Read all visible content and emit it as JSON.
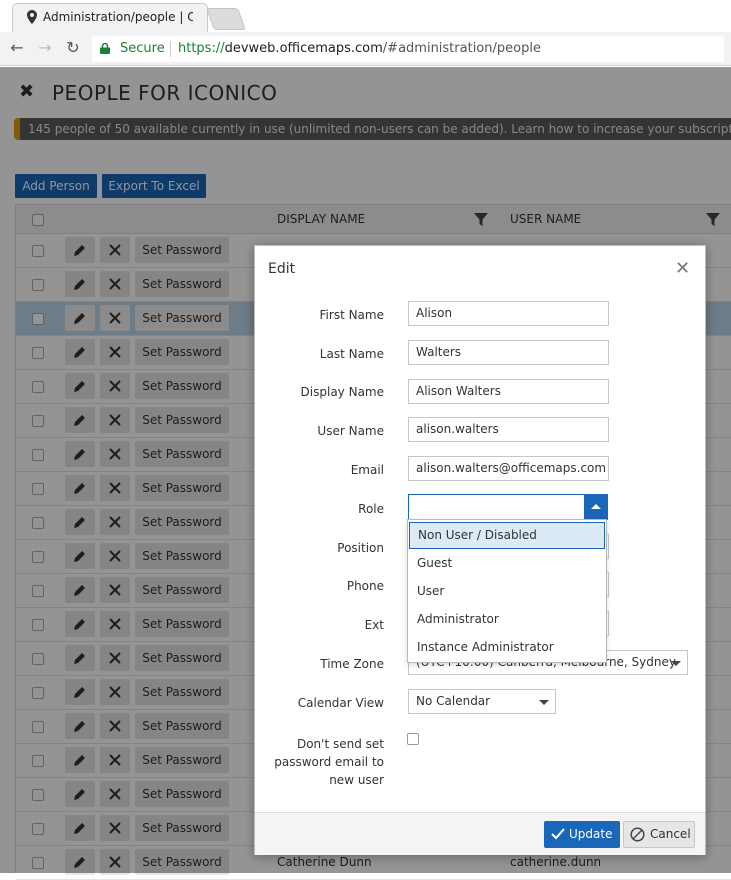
{
  "browser": {
    "tab_title": "Administration/people | O",
    "secure_label": "Secure",
    "url_scheme": "https://",
    "url_host": "devweb.officemaps.com",
    "url_path": "/#administration/people"
  },
  "page": {
    "title": "PEOPLE FOR ICONICO",
    "subscription_notice": "145 people of 50 available currently in use (unlimited non-users can be added). Learn how to increase your subscription.",
    "add_person_label": "Add Person",
    "export_label": "Export To Excel"
  },
  "grid": {
    "columns": [
      "DISPLAY NAME",
      "USER NAME"
    ],
    "set_password_label": "Set Password",
    "last_row": {
      "display_name": "Catherine Dunn",
      "user_name": "catherine.dunn"
    }
  },
  "modal": {
    "title": "Edit",
    "fields": {
      "first_name": {
        "label": "First Name",
        "value": "Alison"
      },
      "last_name": {
        "label": "Last Name",
        "value": "Walters"
      },
      "display_name": {
        "label": "Display Name",
        "value": "Alison Walters"
      },
      "user_name": {
        "label": "User Name",
        "value": "alison.walters"
      },
      "email": {
        "label": "Email",
        "value": "alison.walters@officemaps.com"
      },
      "role": {
        "label": "Role"
      },
      "position": {
        "label": "Position"
      },
      "phone": {
        "label": "Phone"
      },
      "ext": {
        "label": "Ext"
      },
      "time_zone": {
        "label": "Time Zone",
        "value": "(UTC+10:00) Canberra, Melbourne, Sydney"
      },
      "calendar_view": {
        "label": "Calendar View",
        "value": "No Calendar"
      },
      "no_email": {
        "label_lines": [
          "Don't send set",
          "password email to",
          "new user"
        ]
      }
    },
    "role_options": [
      "Non User / Disabled",
      "Guest",
      "User",
      "Administrator",
      "Instance Administrator"
    ],
    "update_label": "Update",
    "cancel_label": "Cancel"
  },
  "colors": {
    "primary": "#1a66b8",
    "notice_accent": "#e0a000",
    "selected_row": "#bdd6ea"
  }
}
